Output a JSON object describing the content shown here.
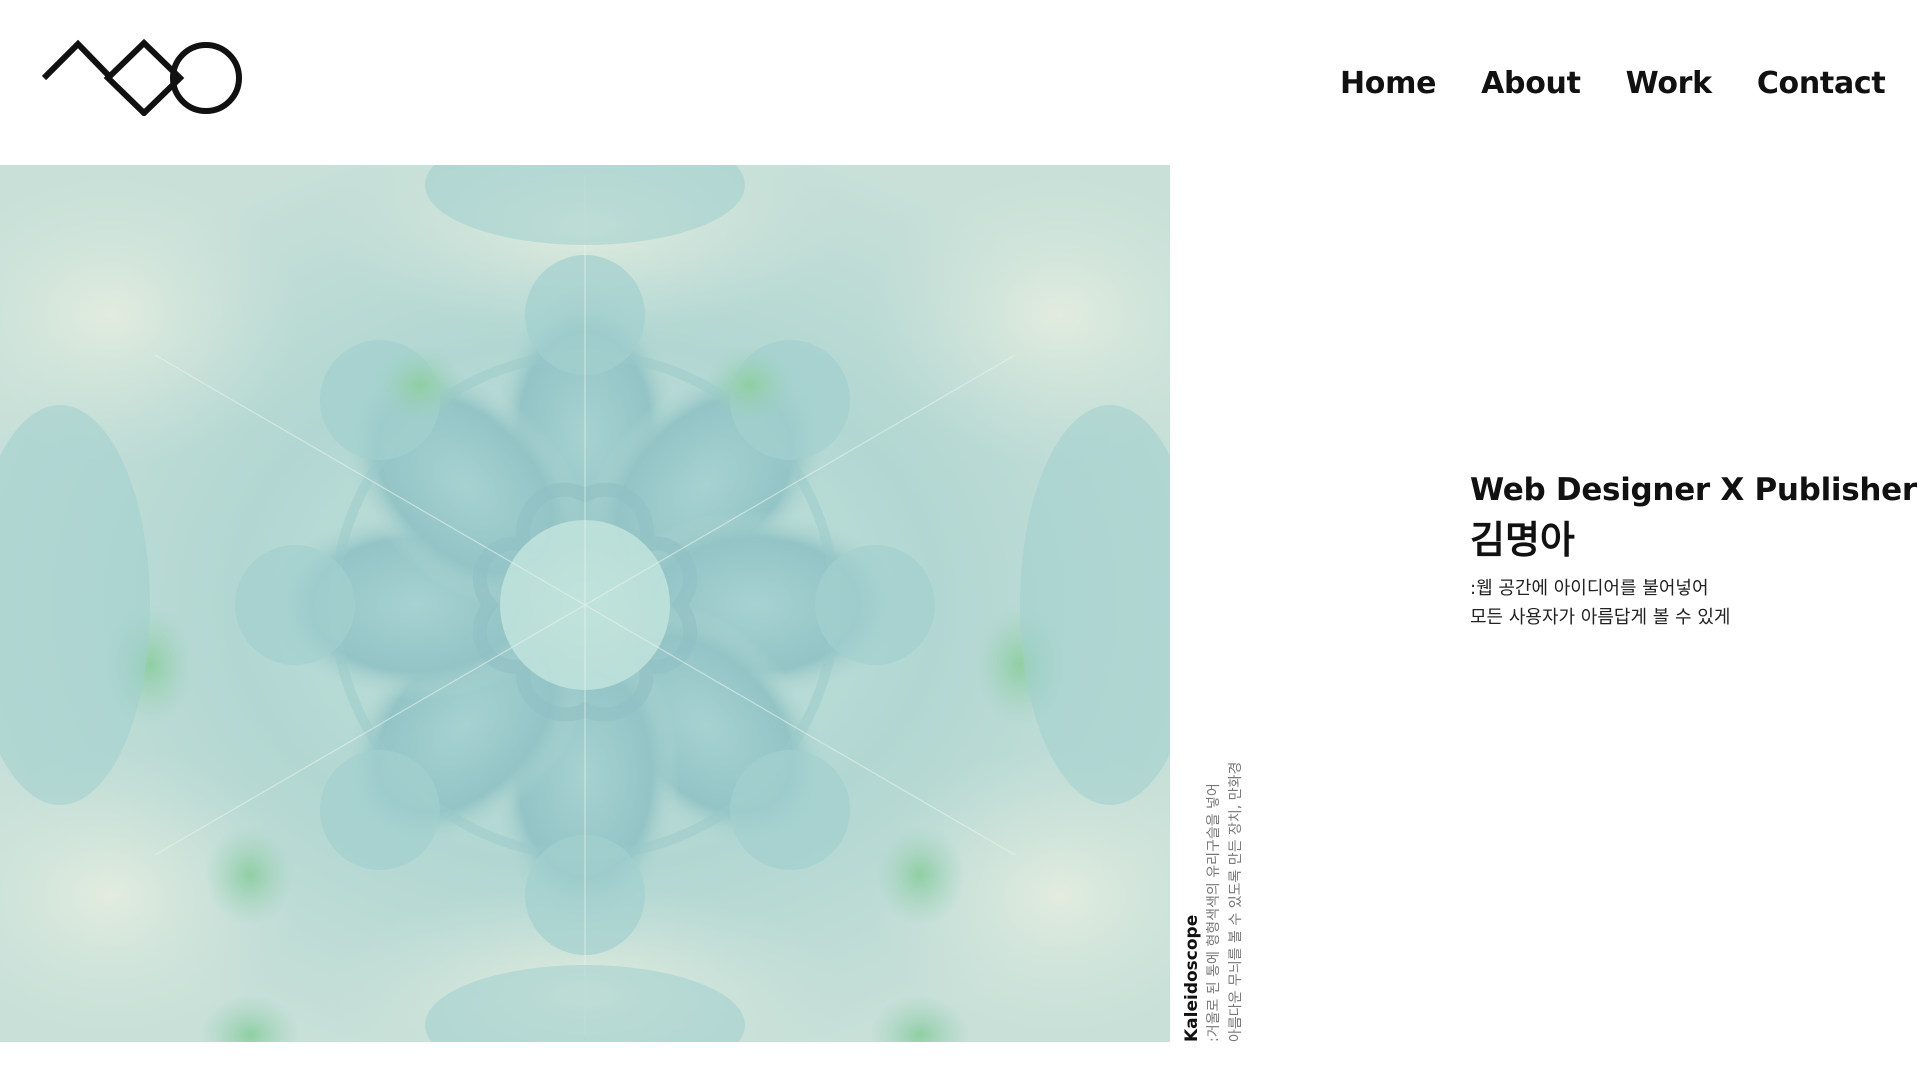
{
  "header": {
    "logo": {
      "icon": "logo-mountain-diamond-circle-icon",
      "color": "#111111"
    },
    "nav": [
      {
        "label": "Home"
      },
      {
        "label": "About"
      },
      {
        "label": "Work"
      },
      {
        "label": "Contact"
      }
    ]
  },
  "hero": {
    "image": "kaleidoscope-image",
    "colors": {
      "base": "#b5d9d3",
      "light": "#d4e7de",
      "deep": "#8fc3c4",
      "green": "#95cfa7"
    },
    "caption": {
      "title": "Kaleidoscope",
      "lines": [
        ":거울로 된 통에 형형색색의 유리구슬을 넣어",
        "아름다운 무늬를 볼 수 있도록 만든 장치, 만화경"
      ]
    }
  },
  "intro": {
    "role": "Web Designer X Publisher",
    "name": "김명아",
    "desc_lines": [
      ":웹 공간에 아이디어를 불어넣어",
      "모든 사용자가 아름답게 볼 수 있게"
    ]
  }
}
